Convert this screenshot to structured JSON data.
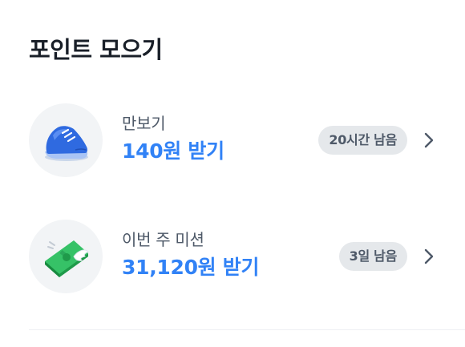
{
  "section": {
    "title": "포인트 모으기"
  },
  "missions": [
    {
      "icon": "sneaker-icon",
      "name": "만보기",
      "reward": "140원 받기",
      "badge": "20시간 남음"
    },
    {
      "icon": "money-wings-icon",
      "name": "이번 주 미션",
      "reward": "31,120원 받기",
      "badge": "3일 남음"
    }
  ],
  "colors": {
    "accent": "#3182f6",
    "title": "#191f28",
    "subtext": "#4e5968",
    "badge_bg": "#e5e8eb",
    "thumb_bg": "#f2f4f6"
  }
}
